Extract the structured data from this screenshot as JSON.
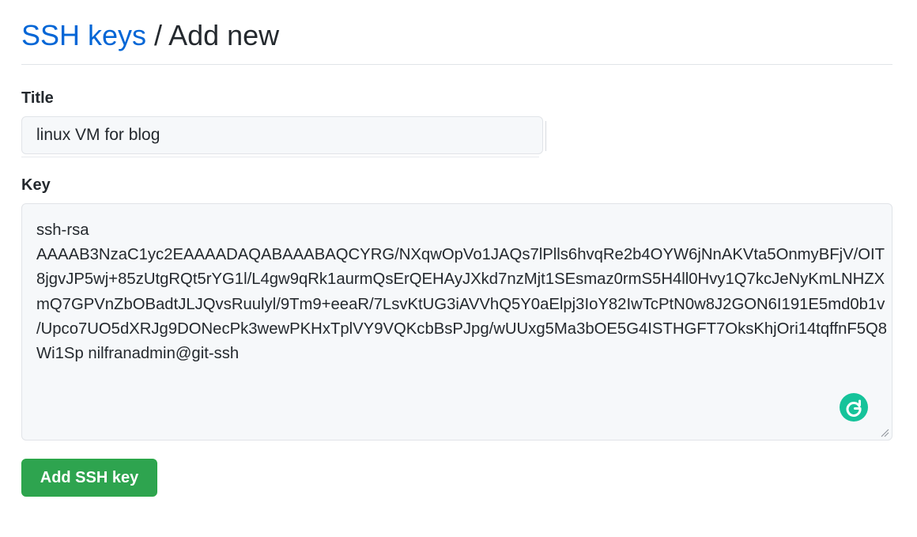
{
  "breadcrumb": {
    "link": "SSH keys",
    "separator": " / ",
    "current": "Add new"
  },
  "form": {
    "title_label": "Title",
    "title_value": "linux VM for blog",
    "key_label": "Key",
    "key_lines": [
      "ssh-rsa",
      "AAAAB3NzaC1yc2EAAAADAQABAAABAQCYRG/NXqwOpVo1JAQs7lPlls6hvqRe2b4OYW6jNnAKVta5OnmyBFjV/OIT",
      "8jgvJP5wj+85zUtgRQt5rYG1l/L4gw9qRk1aurmQsErQEHAyJXkd7nzMjt1SEsmaz0rmS5H4ll0Hvy1Q7kcJeNyKmLNHZX",
      "mQ7GPVnZbOBadtJLJQvsRuulyl/9Tm9+eeaR/7LsvKtUG3iAVVhQ5Y0aElpj3IoY82IwTcPtN0w8J2GON6I191E5md0b1v",
      "/Upco7UO5dXRJg9DONecPk3wewPKHxTplVY9VQKcbBsPJpg/wUUxg5Ma3bOE5G4ISTHGFT7OksKhjOri14tqffnF5Q8",
      "Wi1Sp nilfranadmin@git-ssh"
    ],
    "submit_label": "Add SSH key"
  },
  "colors": {
    "link": "#0366d6",
    "button": "#2ea44f",
    "grammarly": "#15c39a"
  },
  "icons": {
    "grammarly": "grammarly-icon",
    "resize": "resize-handle-icon"
  }
}
